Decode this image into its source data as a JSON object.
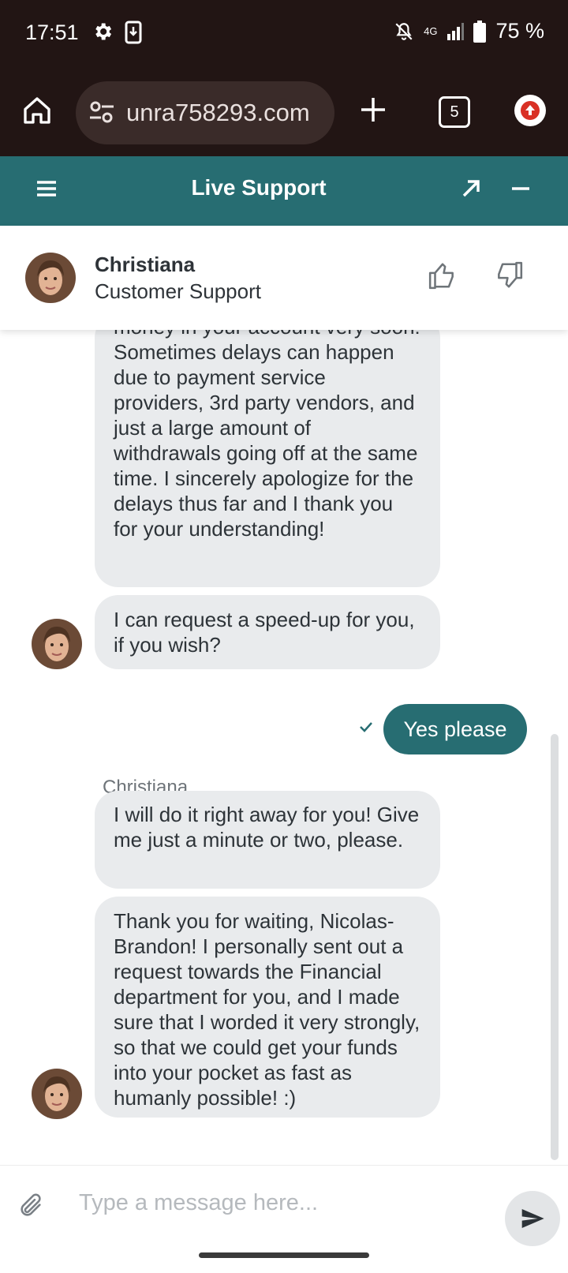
{
  "status_bar": {
    "time": "17:51",
    "network": "4G",
    "battery": "75 %"
  },
  "browser": {
    "url": "unra758293.com",
    "tab_count": "5"
  },
  "chat_header": {
    "title": "Live Support"
  },
  "agent": {
    "name": "Christiana",
    "role": "Customer Support"
  },
  "messages": [
    {
      "from": "agent",
      "text": "money in your account very soon! Sometimes delays can happen due to payment service providers, 3rd party vendors, and just a large amount of withdrawals going off at the same time. I sincerely apologize for the delays thus far and I thank you for your understanding!"
    },
    {
      "from": "agent",
      "text": "I can request a speed-up for you, if you wish?"
    },
    {
      "from": "user",
      "text": "Yes please"
    },
    {
      "from": "agent",
      "text": "I will do it right away for you! Give me just a minute or two, please."
    },
    {
      "from": "agent",
      "text": "Thank you for waiting, Nicolas-Brandon! I personally sent out a request towards the Financial department for you, and I made sure that I worded it very strongly, so that we could get your funds into your pocket as fast as humanly possible! :)"
    }
  ],
  "sender_label": "Christiana",
  "composer": {
    "placeholder": "Type a message here..."
  },
  "colors": {
    "accent": "#276d72",
    "bubble": "#e9ebed",
    "topbar": "#221514"
  },
  "icons": [
    "settings-icon",
    "download-icon",
    "mute-icon",
    "signal-icon",
    "battery-icon",
    "home-icon",
    "tune-icon",
    "plus-icon",
    "tabs-icon",
    "update-icon",
    "menu-icon",
    "expand-icon",
    "minimize-icon",
    "thumbs-up-icon",
    "thumbs-down-icon",
    "checkmark-icon",
    "paperclip-icon",
    "send-icon"
  ]
}
